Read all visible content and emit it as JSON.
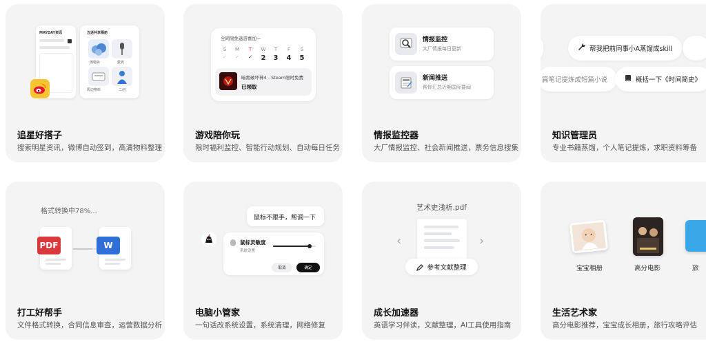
{
  "cards": [
    {
      "title": "追星好搭子",
      "desc": "搜索明星资讯，微博自动签到，高清物料整理",
      "mock": {
        "left_title": "MAYDAY资讯",
        "right_title": "五迷共享相册",
        "tiles": [
          "演唱会",
          "麦克",
          "周边物料",
          "二创"
        ]
      }
    },
    {
      "title": "游戏陪你玩",
      "desc": "限时福利监控、智能行动规划、自动每日任务",
      "mock": {
        "header": "全网限免速游喜加一",
        "weekdays": [
          "S",
          "M",
          "T",
          "W",
          "T",
          "F",
          "S"
        ],
        "dates": [
          "2",
          "3",
          "4",
          "5"
        ],
        "game_title": "暗黑破坏神4 - Steam限时免费",
        "game_status": "已领取"
      }
    },
    {
      "title": "情报监控器",
      "desc": "大厂情报监控、社会新闻推送，票务信息搜集",
      "mock": {
        "items": [
          {
            "title": "情报监控",
            "sub": "大厂情报每日更新",
            "icon": "magnifier-icon"
          },
          {
            "title": "新闻推送",
            "sub": "帮你汇总近期国际要闻",
            "icon": "news-icon"
          }
        ]
      }
    },
    {
      "title": "知识管理员",
      "desc": "专业书籍蒸馏，个人笔记提炼，求职资料筹备",
      "mock": {
        "pill_top": "帮我把前同事小A蒸馏成skill",
        "pill_left": "篇笔记提炼成短篇小说",
        "pill_right": "概括一下《时间简史》"
      }
    },
    {
      "title": "打工好帮手",
      "desc": "文件格式转换，合同信息审查，运营数据分析",
      "mock": {
        "progress_text": "格式转换中78%...",
        "progress": 0.78,
        "from_badge": "PDF",
        "to_badge": "W"
      }
    },
    {
      "title": "电脑小管家",
      "desc": "一句话改系统设置，系统清理，网络修复",
      "mock": {
        "bubble": "鼠标不跟手，帮调一下",
        "setting_title": "鼠标灵敏度",
        "setting_sub": "系统设置",
        "slider_value": 0.85,
        "cancel": "取消",
        "confirm": "确定"
      }
    },
    {
      "title": "成长加速器",
      "desc": "英语学习伴读，文献整理，AI工具使用指南",
      "mock": {
        "file_name": "艺术史浅析.pdf",
        "action": "参考文献整理",
        "prev": "‹",
        "next": "›"
      }
    },
    {
      "title": "生活艺术家",
      "desc": "高分电影推荐，宝宝成长相册，旅行攻略评估",
      "mock": {
        "albums": [
          "宝宝相册",
          "高分电影",
          "旅"
        ]
      }
    }
  ],
  "colors": {
    "card_bg": "#f4f4f5",
    "pdf_red": "#d9393b",
    "word_blue": "#2f6fd6",
    "weibo_yellow": "#f7c531",
    "folder_blue": "#3aa7e8"
  }
}
